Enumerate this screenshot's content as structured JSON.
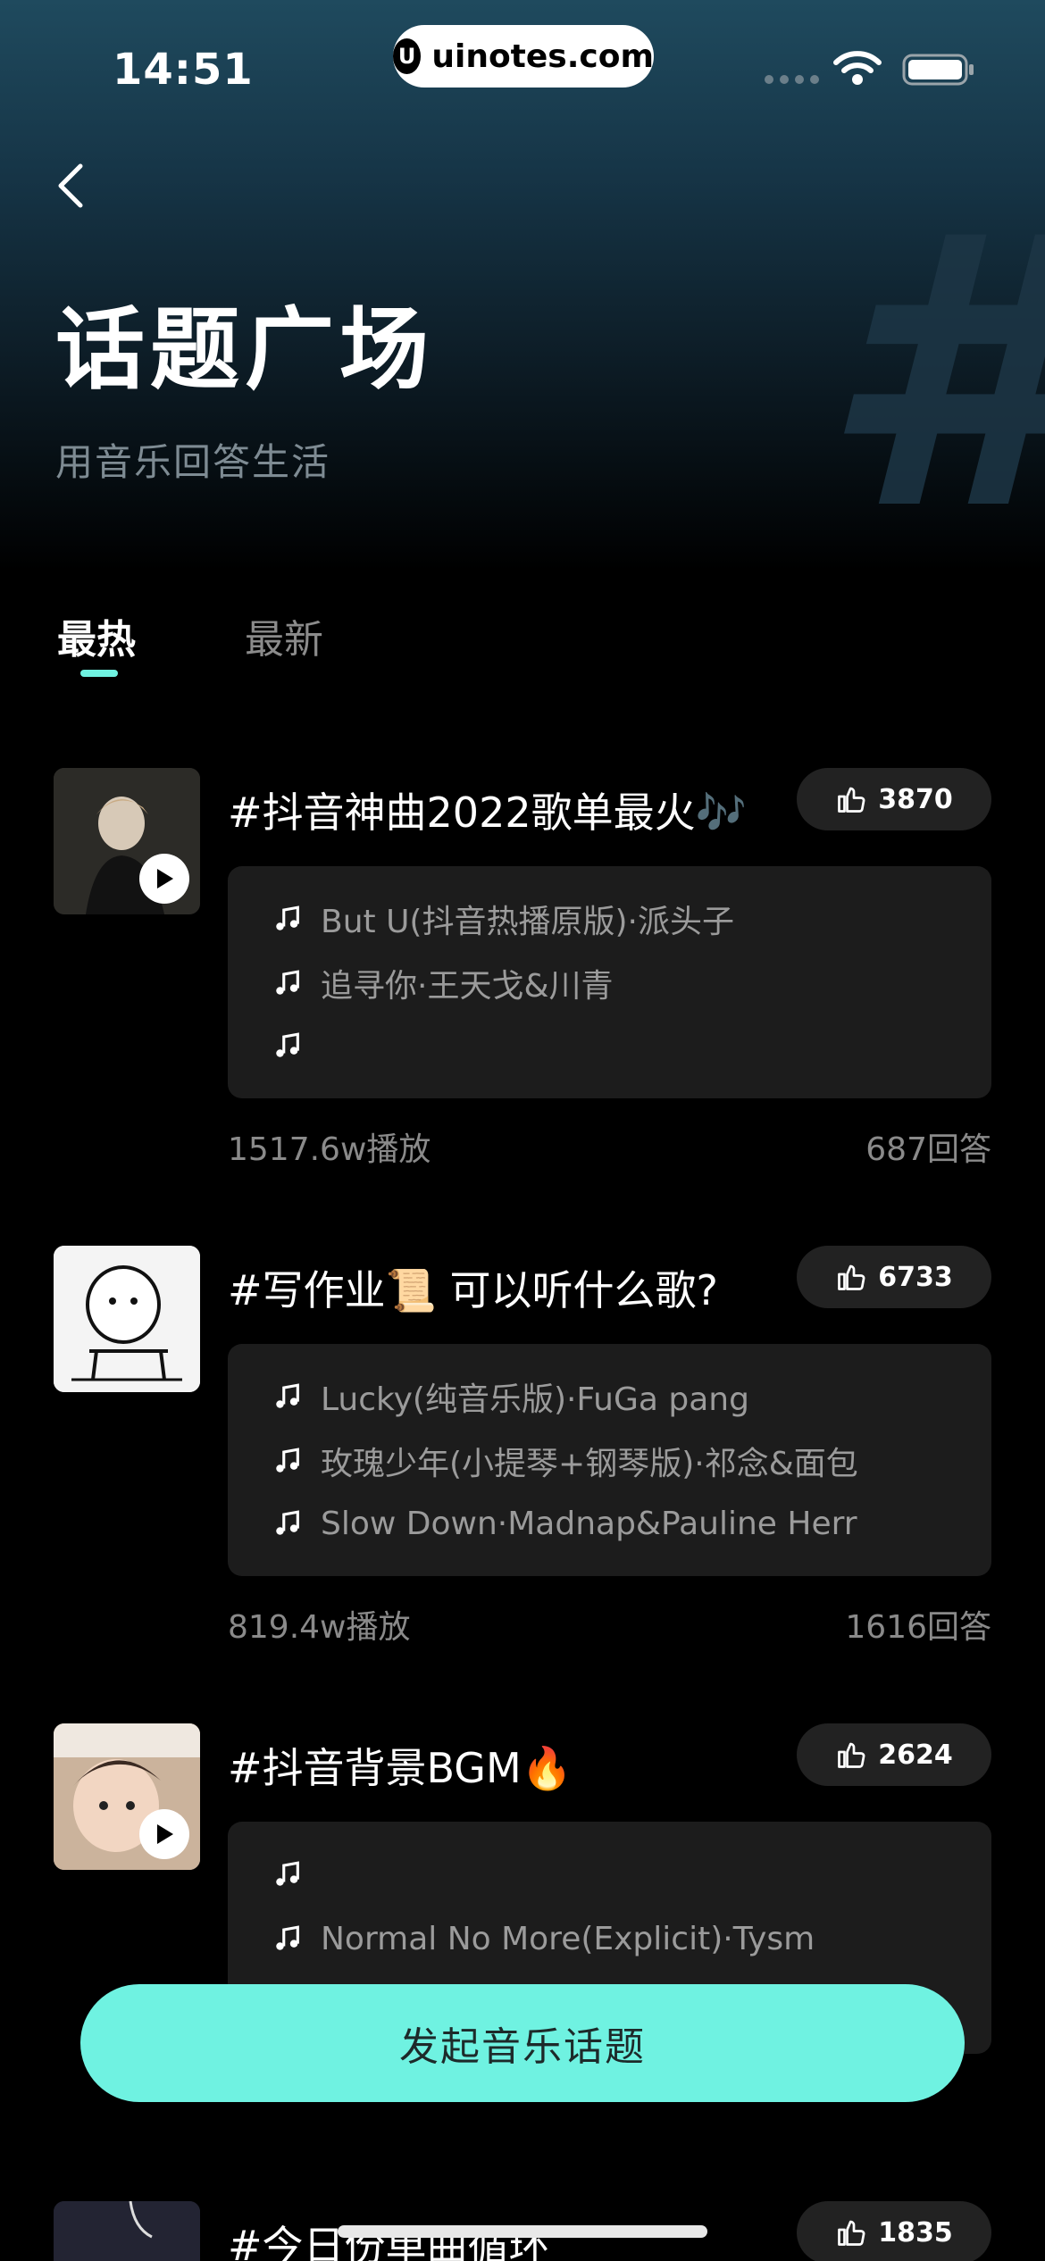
{
  "status_bar": {
    "time": "14:51",
    "watermark": "uinotes.com",
    "watermark_logo": "U"
  },
  "header": {
    "back_icon": "chevron-left-icon",
    "title": "话题广场",
    "subtitle": "用音乐回答生活",
    "decoration": "#"
  },
  "tabs": [
    {
      "label": "最热",
      "active": true
    },
    {
      "label": "最新",
      "active": false
    }
  ],
  "topics": [
    {
      "title": "#抖音神曲2022歌单最火🎶",
      "likes": "3870",
      "songs": [
        "But U(抖音热播原版)·派头子",
        "追寻你·王天戈&川青",
        ""
      ],
      "plays": "1517.6w播放",
      "answers": "687回答"
    },
    {
      "title": "#写作业📜 可以听什么歌?",
      "likes": "6733",
      "songs": [
        "Lucky(纯音乐版)·FuGa pang",
        "玫瑰少年(小提琴+钢琴版)·祁念&面包",
        "Slow Down·Madnap&Pauline Herr"
      ],
      "plays": "819.4w播放",
      "answers": "1616回答"
    },
    {
      "title": "#抖音背景BGM🔥",
      "likes": "2624",
      "songs": [
        "",
        "Normal No More(Explicit)·Tysm",
        ""
      ],
      "plays": "",
      "answers": ""
    },
    {
      "title": "#今日份单曲循环",
      "likes": "1835",
      "songs": [],
      "plays": "",
      "answers": ""
    }
  ],
  "cta": {
    "label": "发起音乐话题"
  },
  "colors": {
    "accent": "#6ff2e1",
    "background": "#000000",
    "card": "#1c1c1c",
    "pill": "#222222"
  }
}
